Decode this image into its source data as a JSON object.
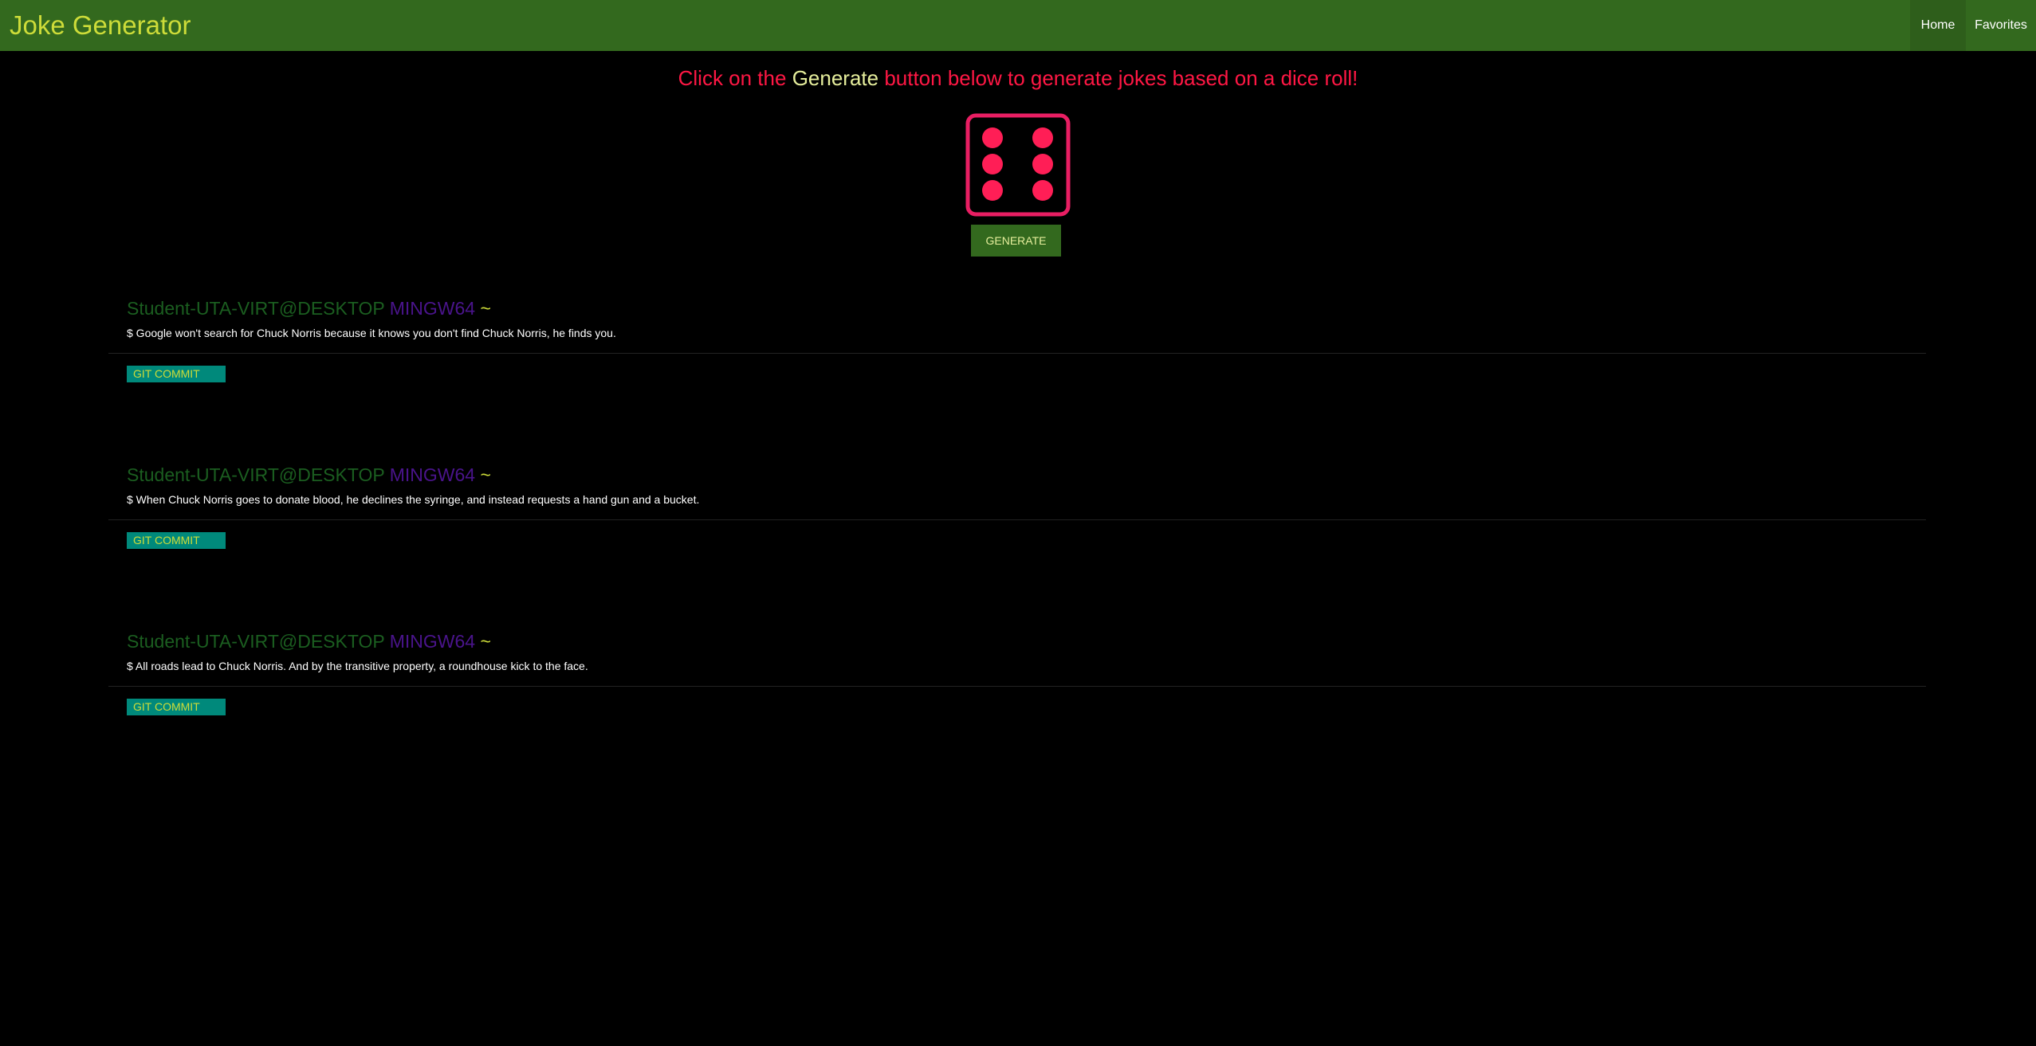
{
  "navbar": {
    "brand": "Joke Generator",
    "links": [
      {
        "label": "Home"
      },
      {
        "label": "Favorites"
      }
    ]
  },
  "headline": {
    "before": "Click on the ",
    "accent": "Generate",
    "after": " button below to generate jokes based on a dice roll!"
  },
  "dice": {
    "value": 6,
    "color": "#ff1744"
  },
  "generate_button": {
    "label": "GENERATE"
  },
  "prompt": {
    "user": "Student-UTA-VIRT@DESKTOP",
    "host": "MINGW64",
    "tilde": "~"
  },
  "jokes": [
    {
      "text": "$ Google won't search for Chuck Norris because it knows you don't find Chuck Norris, he finds you.",
      "button": "GIT COMMIT"
    },
    {
      "text": "$ When Chuck Norris goes to donate blood, he declines the syringe, and instead requests a hand gun and a bucket.",
      "button": "GIT COMMIT"
    },
    {
      "text": "$ All roads lead to Chuck Norris. And by the transitive property, a roundhouse kick to the face.",
      "button": "GIT COMMIT"
    }
  ],
  "colors": {
    "navbar": "#33691e",
    "brand": "#cddc39",
    "headline": "#ff1744",
    "commit_button": "#00897b"
  }
}
